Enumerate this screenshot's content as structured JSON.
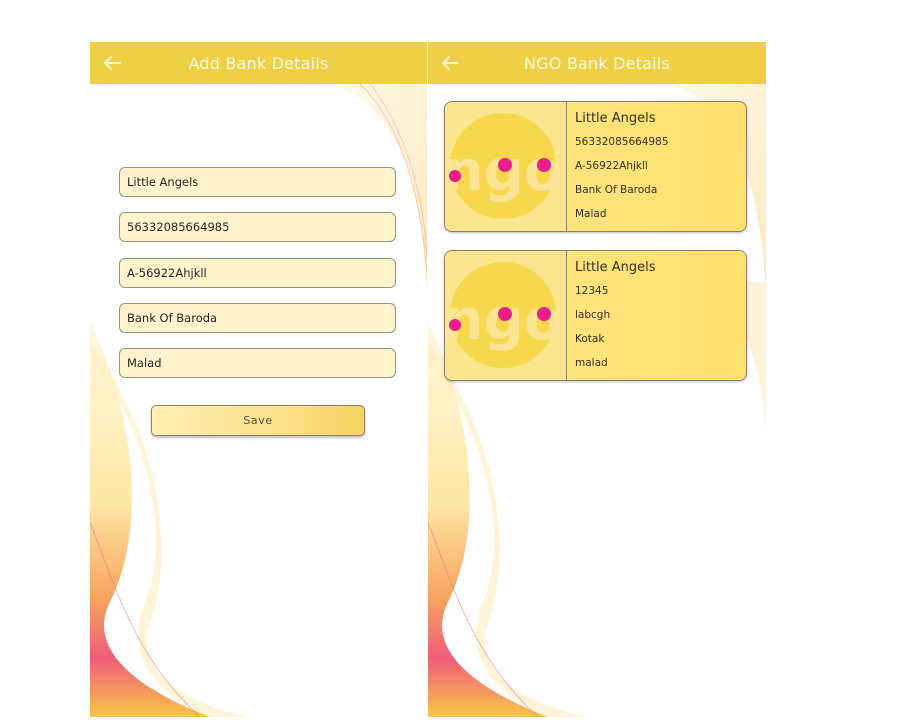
{
  "add_screen": {
    "title": "Add Bank Details",
    "fields": {
      "name": "Little Angels",
      "account": "56332085664985",
      "ifsc": "A-56922Ahjkll",
      "bank": "Bank Of Baroda",
      "branch": "Malad"
    },
    "save_label": "Save"
  },
  "list_screen": {
    "title": "NGO Bank Details",
    "logo_text": "ngo",
    "cards": [
      {
        "name": "Little Angels",
        "account": "56332085664985",
        "ifsc": "A-56922Ahjkll",
        "bank": "Bank Of Baroda",
        "branch": "Malad"
      },
      {
        "name": "Little Angels",
        "account": "12345",
        "ifsc": "labcgh",
        "bank": "Kotak",
        "branch": "malad"
      }
    ]
  },
  "colors": {
    "appbar": "#eecf45",
    "field_bg": "#fff4cd",
    "card_bg": "#fddf6c",
    "logo_circle": "#f7d74b",
    "logo_dot": "#e91e8c"
  }
}
